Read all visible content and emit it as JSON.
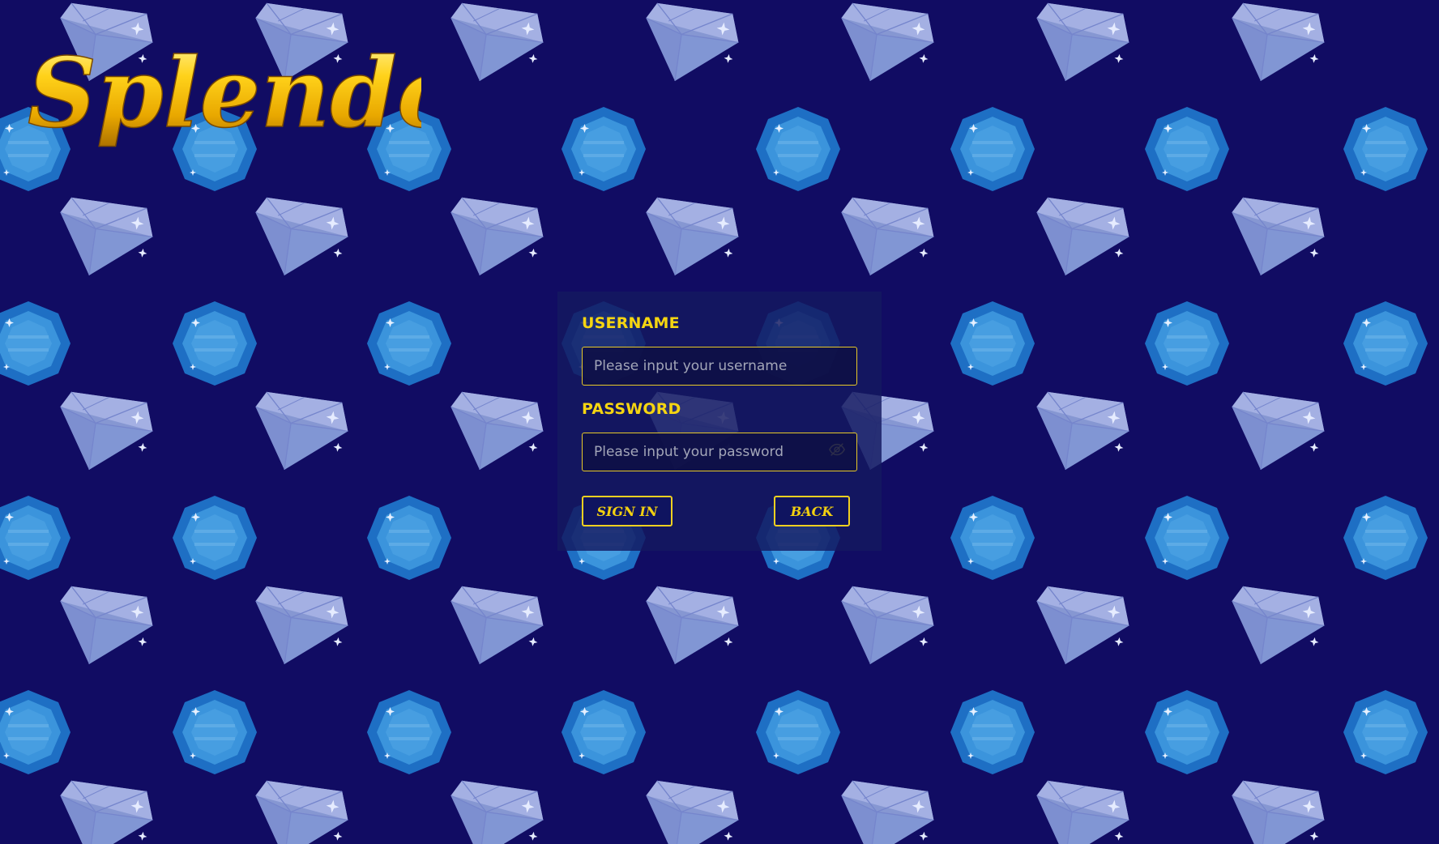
{
  "app": {
    "logo_text": "Splendor"
  },
  "login": {
    "username_label": "USERNAME",
    "username_placeholder": "Please input your username",
    "username_value": "",
    "password_label": "PASSWORD",
    "password_placeholder": "Please input your password",
    "password_value": "",
    "password_toggle_icon": "eye-slash-icon",
    "signin_label": "SIGN IN",
    "back_label": "BACK"
  },
  "colors": {
    "background": "#110c63",
    "accent": "#f5d511",
    "diamond": "#8d9fd8",
    "gem": "#2f8ad8"
  }
}
